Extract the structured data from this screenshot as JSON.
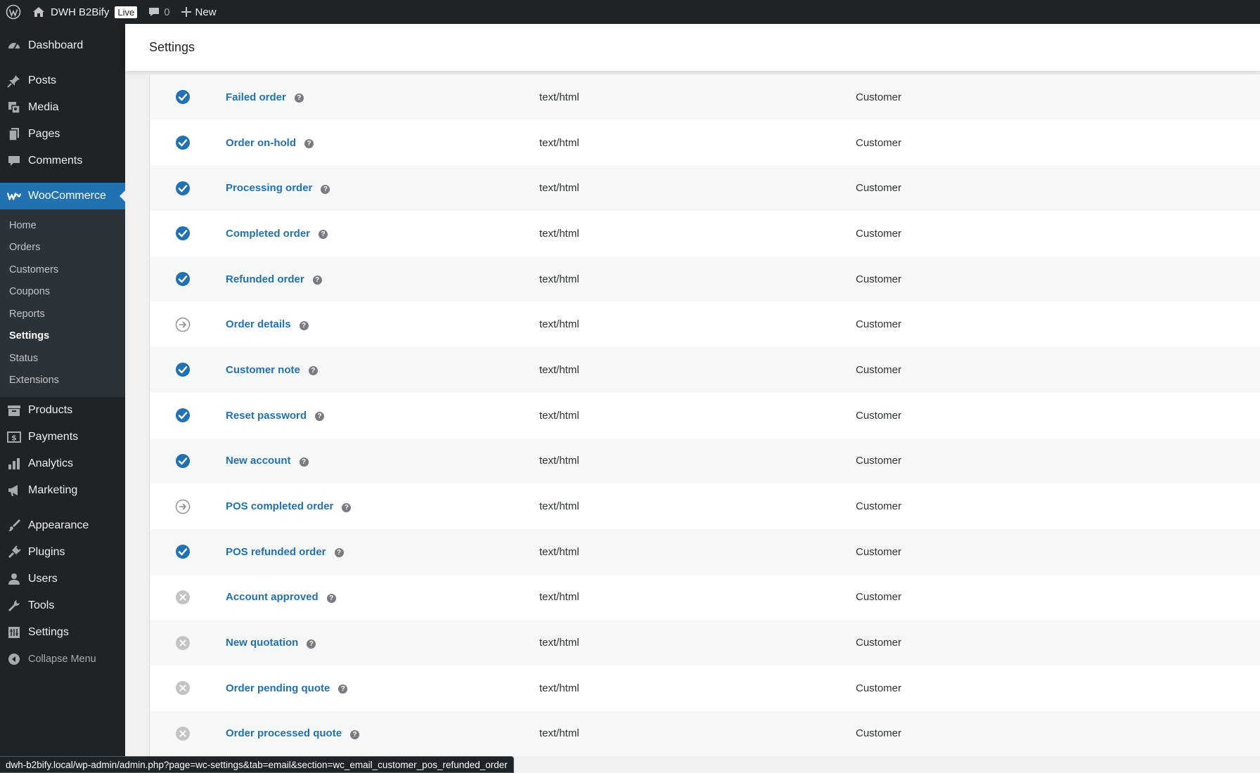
{
  "admin_bar": {
    "site_name": "DWH B2Bify",
    "live_badge": "Live",
    "comment_count": "0",
    "new_label": "New"
  },
  "sidebar": {
    "top_items": [
      {
        "label": "Dashboard",
        "icon": "dashboard-icon"
      }
    ],
    "content_items": [
      {
        "label": "Posts",
        "icon": "pushpin-icon"
      },
      {
        "label": "Media",
        "icon": "media-icon"
      },
      {
        "label": "Pages",
        "icon": "pages-icon"
      },
      {
        "label": "Comments",
        "icon": "comment-icon"
      }
    ],
    "woocommerce": {
      "label": "WooCommerce",
      "icon": "woocommerce-icon"
    },
    "woo_submenu": [
      "Home",
      "Orders",
      "Customers",
      "Coupons",
      "Reports",
      "Settings",
      "Status",
      "Extensions"
    ],
    "woo_submenu_current": "Settings",
    "commerce_items": [
      {
        "label": "Products",
        "icon": "archive-icon"
      },
      {
        "label": "Payments",
        "icon": "money-icon"
      },
      {
        "label": "Analytics",
        "icon": "chart-bar-icon"
      },
      {
        "label": "Marketing",
        "icon": "megaphone-icon"
      }
    ],
    "admin_items": [
      {
        "label": "Appearance",
        "icon": "paintbrush-icon"
      },
      {
        "label": "Plugins",
        "icon": "plugin-icon"
      },
      {
        "label": "Users",
        "icon": "user-icon"
      },
      {
        "label": "Tools",
        "icon": "wrench-icon"
      },
      {
        "label": "Settings",
        "icon": "settings-icon"
      }
    ],
    "collapse_label": "Collapse Menu"
  },
  "header": {
    "title": "Settings"
  },
  "emails": [
    {
      "name": "Failed order",
      "status": "enabled",
      "content_type": "text/html",
      "recipient": "Customer"
    },
    {
      "name": "Order on-hold",
      "status": "enabled",
      "content_type": "text/html",
      "recipient": "Customer"
    },
    {
      "name": "Processing order",
      "status": "enabled",
      "content_type": "text/html",
      "recipient": "Customer"
    },
    {
      "name": "Completed order",
      "status": "enabled",
      "content_type": "text/html",
      "recipient": "Customer"
    },
    {
      "name": "Refunded order",
      "status": "enabled",
      "content_type": "text/html",
      "recipient": "Customer"
    },
    {
      "name": "Order details",
      "status": "manual",
      "content_type": "text/html",
      "recipient": "Customer"
    },
    {
      "name": "Customer note",
      "status": "enabled",
      "content_type": "text/html",
      "recipient": "Customer"
    },
    {
      "name": "Reset password",
      "status": "enabled",
      "content_type": "text/html",
      "recipient": "Customer"
    },
    {
      "name": "New account",
      "status": "enabled",
      "content_type": "text/html",
      "recipient": "Customer"
    },
    {
      "name": "POS completed order",
      "status": "manual",
      "content_type": "text/html",
      "recipient": "Customer"
    },
    {
      "name": "POS refunded order",
      "status": "enabled",
      "content_type": "text/html",
      "recipient": "Customer"
    },
    {
      "name": "Account approved",
      "status": "disabled",
      "content_type": "text/html",
      "recipient": "Customer"
    },
    {
      "name": "New quotation",
      "status": "disabled",
      "content_type": "text/html",
      "recipient": "Customer"
    },
    {
      "name": "Order pending quote",
      "status": "disabled",
      "content_type": "text/html",
      "recipient": "Customer"
    },
    {
      "name": "Order processed quote",
      "status": "disabled",
      "content_type": "text/html",
      "recipient": "Customer"
    }
  ],
  "help_glyph": "?",
  "status_url": "dwh-b2bify.local/wp-admin/admin.php?page=wc-settings&tab=email&section=wc_email_customer_pos_refunded_order",
  "colors": {
    "accent": "#2271b1",
    "sidebar_bg": "#1d2327",
    "submenu_bg": "#2c3338",
    "disabled_icon": "#c3c4c7"
  }
}
